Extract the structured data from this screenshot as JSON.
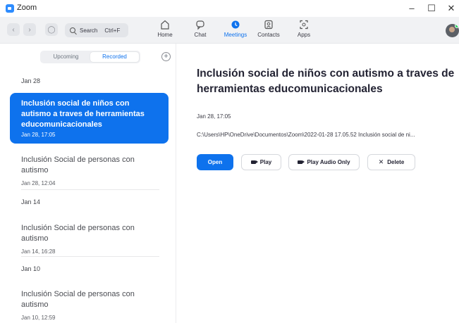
{
  "window": {
    "title": "Zoom",
    "controls": {
      "minimize": "–",
      "maximize": "☐",
      "close": "✕"
    }
  },
  "toolbar": {
    "search_label": "Search",
    "search_shortcut": "Ctrl+F",
    "tabs": [
      {
        "label": "Home",
        "icon": "home-icon",
        "active": false
      },
      {
        "label": "Chat",
        "icon": "chat-icon",
        "active": false
      },
      {
        "label": "Meetings",
        "icon": "clock-icon",
        "active": true
      },
      {
        "label": "Contacts",
        "icon": "contacts-icon",
        "active": false
      },
      {
        "label": "Apps",
        "icon": "apps-icon",
        "active": false
      }
    ],
    "accent_color": "#0e72ed",
    "status_color": "#23d959"
  },
  "sidebar": {
    "segments": [
      {
        "label": "Upcoming",
        "active": false
      },
      {
        "label": "Recorded",
        "active": true
      }
    ],
    "add_label": "+",
    "groups": [
      {
        "date": "Jan 28",
        "items": [
          {
            "title": "Inclusión social de niños con autismo a traves de herramientas educomunicacionales",
            "time": "Jan 28, 17:05",
            "selected": true
          },
          {
            "title": "Inclusión Social de personas con autismo",
            "time": "Jan 28, 12:04",
            "selected": false
          }
        ]
      },
      {
        "date": "Jan 14",
        "items": [
          {
            "title": "Inclusión Social de personas con autismo",
            "time": "Jan 14, 16:28",
            "selected": false
          }
        ]
      },
      {
        "date": "Jan 10",
        "items": [
          {
            "title": "Inclusión Social de personas con autismo",
            "time": "Jan 10, 12:59",
            "selected": false
          }
        ]
      }
    ]
  },
  "main": {
    "title": "Inclusión social de niños con autismo a traves de herramientas educomunicacionales",
    "date": "Jan 28, 17:05",
    "path": "C:\\Users\\HP\\OneDrive\\Documentos\\Zoom\\2022-01-28 17.05.52 Inclusión social de ni...",
    "buttons": {
      "open": "Open",
      "play": "Play",
      "play_audio": "Play Audio Only",
      "delete": "Delete"
    }
  }
}
